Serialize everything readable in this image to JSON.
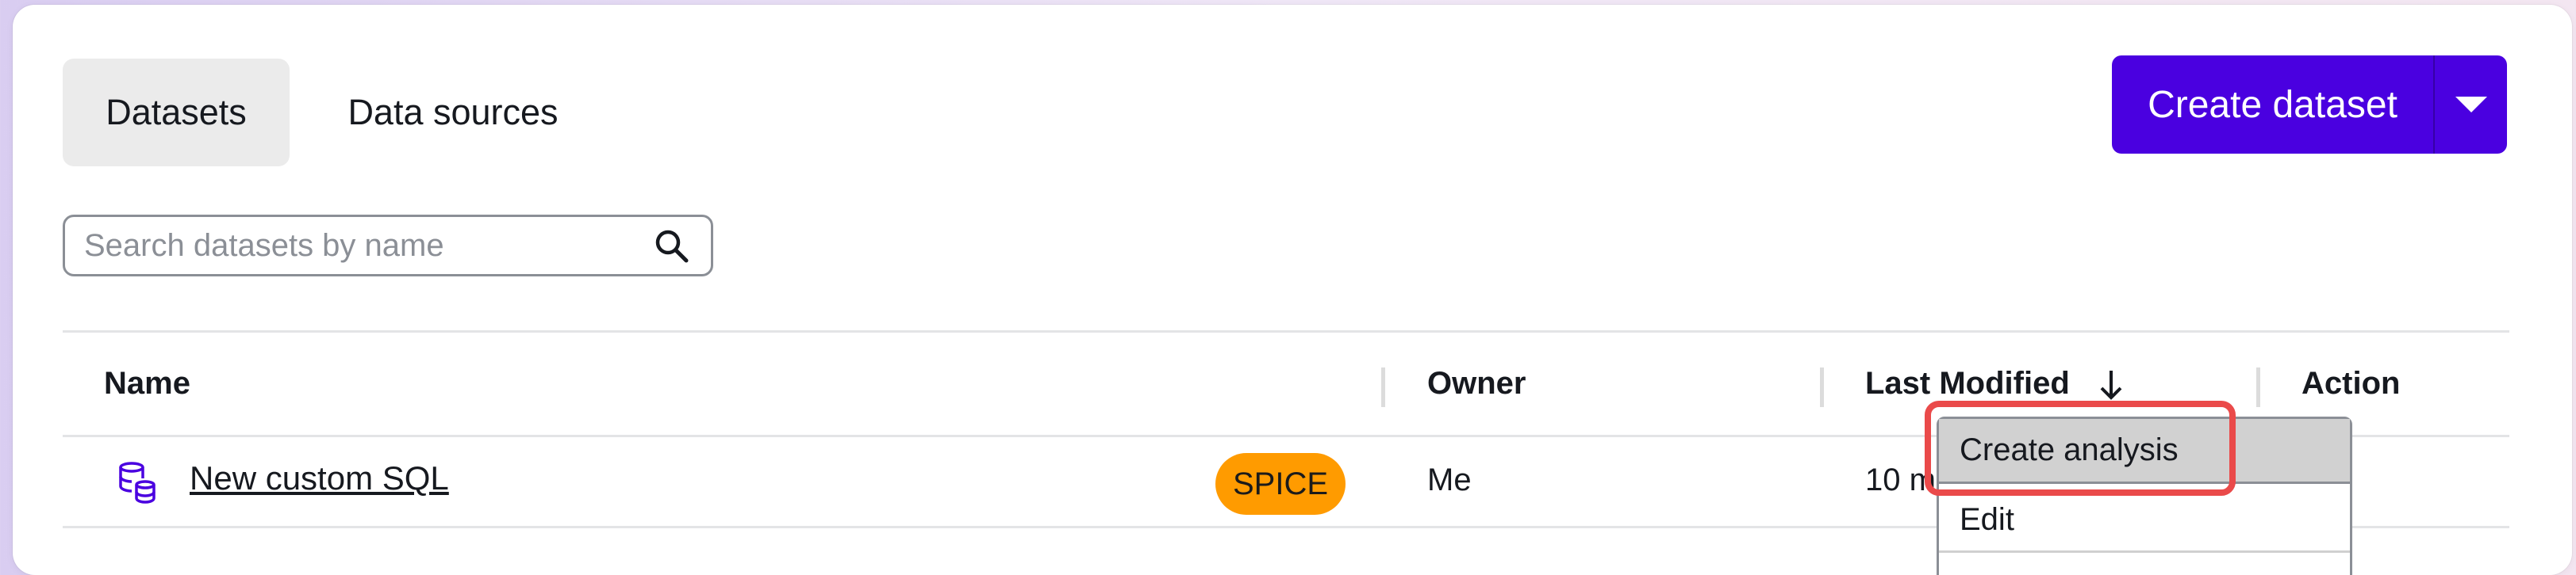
{
  "tabs": [
    {
      "label": "Datasets",
      "selected": true
    },
    {
      "label": "Data sources",
      "selected": false
    }
  ],
  "create_button": {
    "label": "Create dataset"
  },
  "search": {
    "placeholder": "Search datasets by name",
    "value": ""
  },
  "table": {
    "columns": [
      "Name",
      "Owner",
      "Last Modified",
      "Action"
    ],
    "sort_column": "Last Modified",
    "sort_direction": "descending",
    "rows": [
      {
        "name": "New custom SQL",
        "storage": "SPICE",
        "owner": "Me",
        "last_modified": "10 m"
      }
    ]
  },
  "context_menu": {
    "items": [
      "Create analysis",
      "Edit"
    ],
    "highlighted": "Create analysis"
  },
  "colors": {
    "primary": "#4a00e0",
    "badge": "#ff9b00",
    "highlight_box": "#ea4a4a",
    "menu_hover": "#d1d1d1"
  }
}
